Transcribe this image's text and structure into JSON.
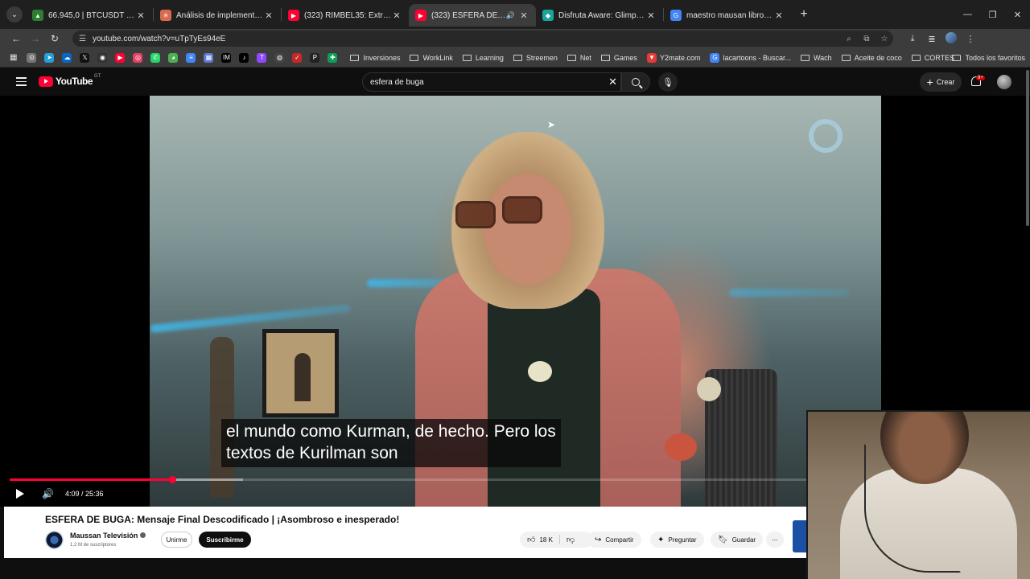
{
  "browser": {
    "tabs": [
      {
        "title": "66.945,0 | BTCUSDT Futuros - Bina",
        "favicon_color": "#2e7d32",
        "favicon_glyph": "▲",
        "active": false,
        "audio": false
      },
      {
        "title": "Análisis de implementación de",
        "favicon_color": "#d86a50",
        "favicon_glyph": "✳",
        "active": false,
        "audio": false
      },
      {
        "title": "(323) RIMBEL35: Extraterrestres",
        "favicon_color": "#ff0033",
        "favicon_glyph": "▶",
        "active": false,
        "audio": false
      },
      {
        "title": "(323) ESFERA DE BUGA: Me",
        "favicon_color": "#ff0033",
        "favicon_glyph": "▶",
        "active": true,
        "audio": true
      },
      {
        "title": "Disfruta Aware: Glimpses of Co",
        "favicon_color": "#1aa59a",
        "favicon_glyph": "◆",
        "active": false,
        "audio": false
      },
      {
        "title": "maestro mausan libro - Buscar",
        "favicon_color": "#4285f4",
        "favicon_glyph": "G",
        "active": false,
        "audio": false
      }
    ],
    "url": "youtube.com/watch?v=uTpTyEs94eE",
    "bookmark_icons": [
      {
        "color": "#777",
        "glyph": "⊙"
      },
      {
        "color": "#229ed9",
        "glyph": "➤"
      },
      {
        "color": "#0a66c2",
        "glyph": "☁"
      },
      {
        "color": "#111",
        "glyph": "𝕏"
      },
      {
        "color": "#333",
        "glyph": "◉"
      },
      {
        "color": "#ff0033",
        "glyph": "▶"
      },
      {
        "color": "#e4405f",
        "glyph": "◎"
      },
      {
        "color": "#25d366",
        "glyph": "✆"
      },
      {
        "color": "#4caf50",
        "glyph": "◕"
      },
      {
        "color": "#4285f4",
        "glyph": "≡"
      },
      {
        "color": "#5a7bd6",
        "glyph": "▦"
      },
      {
        "color": "#000",
        "glyph": "IM"
      },
      {
        "color": "#000",
        "glyph": "♪"
      },
      {
        "color": "#9146ff",
        "glyph": "T"
      },
      {
        "color": "#444",
        "glyph": "◍"
      },
      {
        "color": "#c62828",
        "glyph": "✓"
      },
      {
        "color": "#222",
        "glyph": "P"
      },
      {
        "color": "#0f9d58",
        "glyph": "✚"
      }
    ],
    "bookmarks": [
      {
        "label": "Inversiones",
        "type": "folder"
      },
      {
        "label": "WorkLink",
        "type": "folder"
      },
      {
        "label": "Learning",
        "type": "folder"
      },
      {
        "label": "Streemen",
        "type": "folder"
      },
      {
        "label": "Net",
        "type": "folder"
      },
      {
        "label": "Games",
        "type": "folder"
      },
      {
        "label": "Y2mate.com",
        "type": "site"
      },
      {
        "label": "lacartoons - Buscar...",
        "type": "site"
      },
      {
        "label": "Wach",
        "type": "folder"
      },
      {
        "label": "Aceite de coco",
        "type": "folder"
      },
      {
        "label": "CORTES",
        "type": "folder"
      }
    ],
    "all_bookmarks_label": "Todos los favoritos"
  },
  "youtube": {
    "logo_text": "YouTube",
    "country_code": "GT",
    "search_value": "esfera de buga",
    "create_label": "Crear",
    "notification_badge": "9+",
    "subtitle_line1": "el mundo como Kurman, de hecho. Pero los",
    "subtitle_line2": "textos de Kurilman son",
    "time_display": "4:09 / 25:36",
    "progress_fraction": 0.162,
    "video_title": "ESFERA DE BUGA: Mensaje Final Descodificado | ¡Asombroso e inesperado!",
    "channel_name": "Maussan Televisión",
    "subscriber_count": "1,2 M de suscriptores",
    "join_label": "Unirme",
    "subscribe_label": "Suscribirme",
    "like_count": "18 K",
    "share_label": "Compartir",
    "ask_label": "Preguntar",
    "save_label": "Guardar"
  }
}
